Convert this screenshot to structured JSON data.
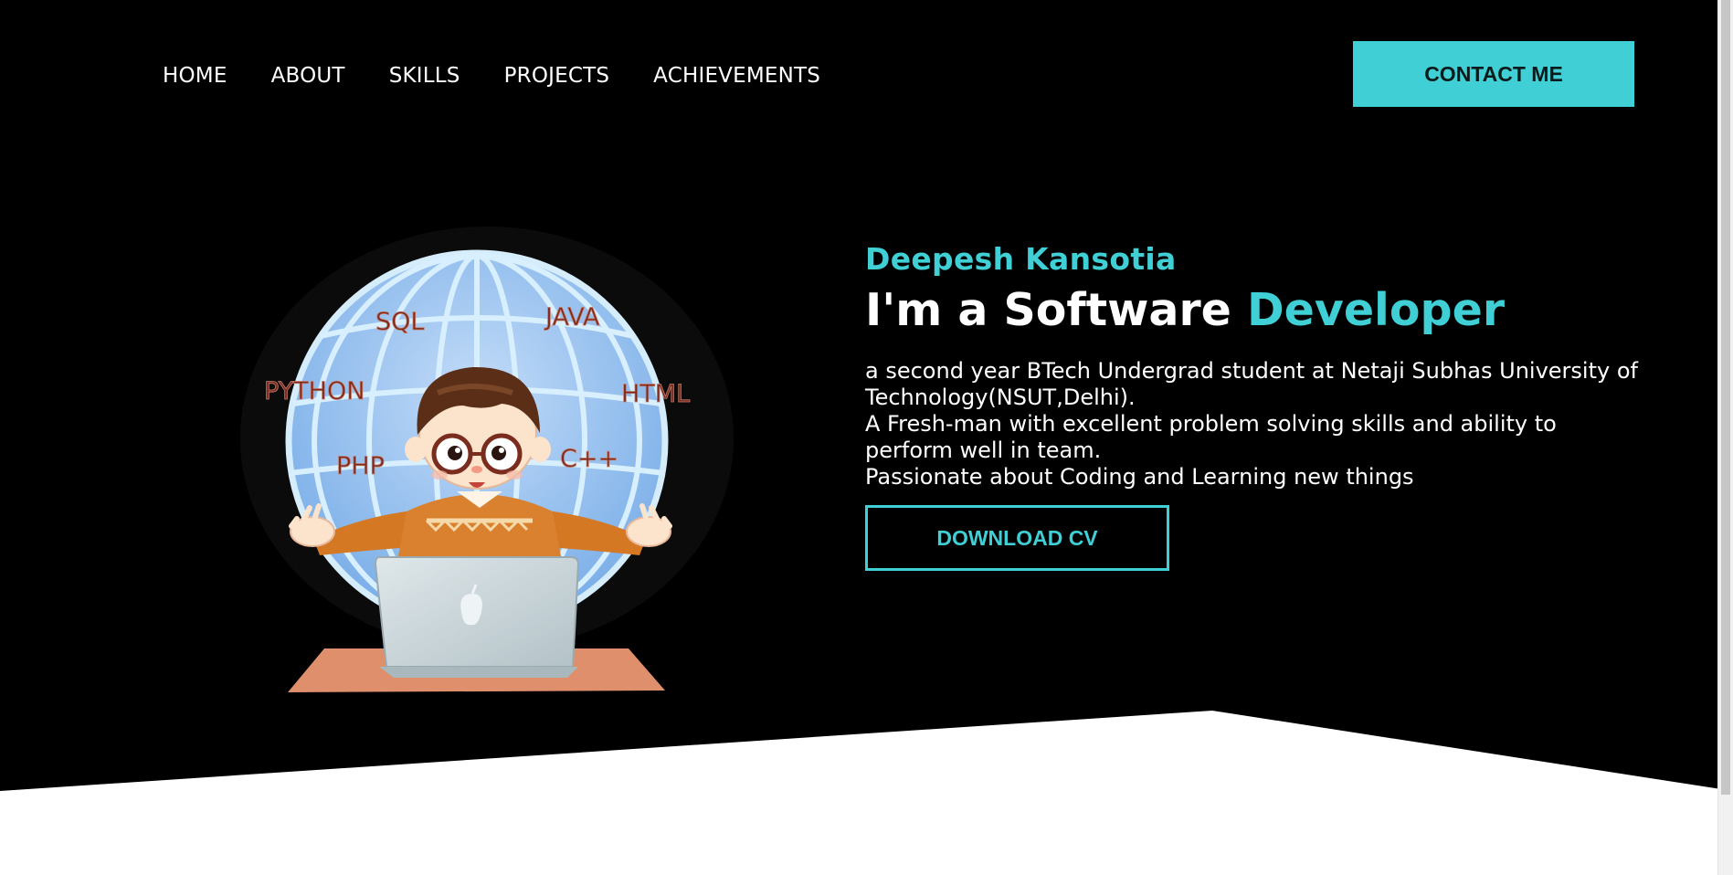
{
  "nav": {
    "items": [
      {
        "label": "HOME"
      },
      {
        "label": "ABOUT"
      },
      {
        "label": "SKILLS"
      },
      {
        "label": "PROJECTS"
      },
      {
        "label": "ACHIEVEMENTS"
      }
    ],
    "contact_label": "CONTACT ME"
  },
  "illustration": {
    "globe_labels": [
      "SQL",
      "JAVA",
      "PYTHON",
      "HTML",
      "PHP",
      "C++"
    ]
  },
  "hero": {
    "name": "Deepesh Kansotia",
    "title_prefix": "I'm a Software ",
    "title_accent": "Developer",
    "description_lines": [
      "a second year BTech Undergrad student at Netaji Subhas University of Technology(NSUT,Delhi).",
      "A Fresh-man with excellent problem solving skills and ability to perform well in team.",
      "Passionate about Coding and Learning new things"
    ],
    "download_label": "DOWNLOAD CV"
  },
  "colors": {
    "accent": "#3fcfd5",
    "background": "#000000",
    "text": "#ffffff"
  }
}
